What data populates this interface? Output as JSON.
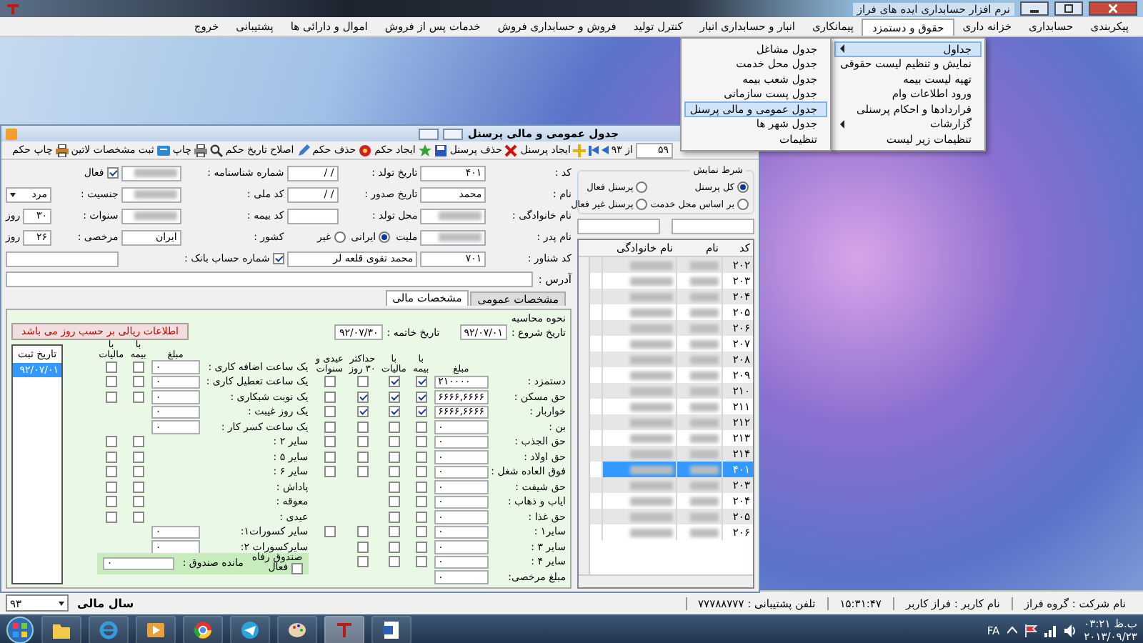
{
  "app_title": "نرم افزار حسابداری ایده های فراز",
  "menu_bar": [
    {
      "label": "پیکربندی",
      "selected": false
    },
    {
      "label": "حسابداری",
      "selected": false
    },
    {
      "label": "خزانه داری",
      "selected": false
    },
    {
      "label": "حقوق و دستمزد",
      "selected": true
    },
    {
      "label": "پیمانکاری",
      "selected": false
    },
    {
      "label": "انبار و حسابداری انبار",
      "selected": false
    },
    {
      "label": "کنترل تولید",
      "selected": false
    },
    {
      "label": "فروش و حسابداری فروش",
      "selected": false
    },
    {
      "label": "خدمات پس از فروش",
      "selected": false
    },
    {
      "label": "اموال و دارائی ها",
      "selected": false
    },
    {
      "label": "پشتیبانی",
      "selected": false
    },
    {
      "label": "خروج",
      "selected": false
    }
  ],
  "payroll_menu": [
    {
      "label": "جداول",
      "selected": true,
      "has_submenu": true
    },
    {
      "label": "نمایش و تنظیم لیست حقوقی",
      "selected": false,
      "has_submenu": false
    },
    {
      "label": "تهیه لیست بیمه",
      "selected": false,
      "has_submenu": false
    },
    {
      "label": "ورود اطلاعات وام",
      "selected": false,
      "has_submenu": false
    },
    {
      "label": "قراردادها و احکام پرسنلی",
      "selected": false,
      "has_submenu": false
    },
    {
      "label": "گزارشات",
      "selected": false,
      "has_submenu": true
    },
    {
      "label": "تنظیمات زیر لیست",
      "selected": false,
      "has_submenu": false
    }
  ],
  "tables_submenu": [
    {
      "label": "جدول مشاغل",
      "selected": false
    },
    {
      "label": "جدول محل خدمت",
      "selected": false
    },
    {
      "label": "جدول شعب بیمه",
      "selected": false
    },
    {
      "label": "جدول پست سازمانی",
      "selected": false
    },
    {
      "label": "جدول عمومی و مالی پرسنل",
      "selected": true
    },
    {
      "label": "جدول شهر ها",
      "selected": false
    },
    {
      "label": "تنظیمات",
      "selected": false
    }
  ],
  "window": {
    "title": "جدول عمومی و مالی پرسنل",
    "toolbar": {
      "record": "۵۹",
      "record_count": "از ۹۳",
      "buttons": [
        {
          "kind": "add",
          "label": "ایجاد پرسنل"
        },
        {
          "kind": "delete",
          "label": "حذف پرسنل"
        },
        {
          "kind": "save"
        },
        {
          "kind": "new_order",
          "label": "ایجاد حکم"
        },
        {
          "kind": "delete_order",
          "label": "حذف حکم"
        },
        {
          "kind": "edit",
          "label": "اصلاح تاریخ حکم"
        },
        {
          "kind": "search"
        },
        {
          "kind": "print",
          "label": "چاپ"
        },
        {
          "kind": "latin",
          "label": "ثبت مشخصات لاتین"
        },
        {
          "kind": "print_order",
          "label": "چاپ حکم"
        }
      ]
    },
    "display_filter": {
      "title": "شرط نمایش",
      "options": [
        {
          "label": "کل پرسنل",
          "selected": true
        },
        {
          "label": "پرسنل فعال",
          "selected": false
        },
        {
          "label": "بر اساس محل خدمت",
          "selected": false
        },
        {
          "label": "پرسنل غیر فعال",
          "selected": false
        }
      ]
    },
    "personnel_list": {
      "columns": [
        "کد",
        "نام",
        "نام خانوادگی"
      ],
      "rows": [
        {
          "code": "۲۰۲",
          "selected": false
        },
        {
          "code": "۲۰۳",
          "selected": false
        },
        {
          "code": "۲۰۴",
          "selected": false
        },
        {
          "code": "۲۰۵",
          "selected": false
        },
        {
          "code": "۲۰۶",
          "selected": false
        },
        {
          "code": "۲۰۷",
          "selected": false
        },
        {
          "code": "۲۰۸",
          "selected": false
        },
        {
          "code": "۲۰۹",
          "selected": false
        },
        {
          "code": "۲۱۰",
          "selected": false
        },
        {
          "code": "۲۱۱",
          "selected": false
        },
        {
          "code": "۲۱۲",
          "selected": false
        },
        {
          "code": "۲۱۳",
          "selected": false
        },
        {
          "code": "۲۱۴",
          "selected": false
        },
        {
          "code": "۴۰۱",
          "selected": true
        },
        {
          "code": "۲۰۳",
          "selected": false
        },
        {
          "code": "۲۰۴",
          "selected": false
        },
        {
          "code": "۲۰۵",
          "selected": false
        },
        {
          "code": "۲۰۶",
          "selected": false
        }
      ]
    },
    "fields": [
      [
        {
          "label": "کد :",
          "value": "۴۰۱"
        },
        {
          "label": "تاریخ تولد :",
          "value": "/ /"
        },
        {
          "label": "شماره شناسنامه :",
          "redacted": true
        },
        {
          "kind": "checkbox",
          "label": "فعال",
          "checked": true
        }
      ],
      [
        {
          "label": "نام :",
          "value": "محمد"
        },
        {
          "label": "تاریخ صدور :",
          "value": "/ /"
        },
        {
          "label": "کد ملی :",
          "redacted": true
        },
        {
          "kind": "dropdown",
          "label": "جنسیت :",
          "value": "مرد"
        }
      ],
      [
        {
          "label": "نام خانوادگی :",
          "redacted": true
        },
        {
          "label": "محل تولد :"
        },
        {
          "label": "کد بیمه :",
          "redacted": true
        },
        {
          "kind": "days",
          "label": "سنوات :",
          "value": "۳۰",
          "unit": "روز"
        }
      ],
      [
        {
          "label": "نام پدر :",
          "redacted": true
        },
        {
          "kind": "radios",
          "label": "ملیت",
          "options": [
            {
              "label": "ایرانی",
              "selected": true
            },
            {
              "label": "غیر",
              "selected": false
            }
          ]
        },
        {
          "label": "کشور :",
          "value": "ایران"
        },
        {
          "kind": "days",
          "label": "مرخصی :",
          "value": "۲۶",
          "unit": "روز"
        }
      ],
      [
        {
          "label": "کد شناور :",
          "value": "۷۰۱"
        },
        {
          "kind": "wide",
          "value": "محمد تقوی قلعه لر"
        },
        {
          "kind": "checkbox",
          "label": "شماره حساب بانک :",
          "checked": true
        },
        {
          "kind": "wide"
        }
      ]
    ],
    "address": {
      "label": "آدرس :"
    },
    "tabs": [
      {
        "label": "مشخصات عمومی",
        "selected": false
      },
      {
        "label": "مشخصات مالی",
        "selected": true
      }
    ],
    "financial": {
      "calc_title": "نحوه محاسبه",
      "start": {
        "label": "تاریخ شروع :",
        "value": "۹۲/۰۷/۰۱"
      },
      "end": {
        "label": "تاریخ خاتمه :",
        "value": "۹۲/۰۷/۳۰"
      },
      "note": "اطلاعات ریالی بر حسب روز می باشد",
      "earnings_columns": [
        "مبلغ",
        "با بیمه",
        "با مالیات",
        "حداکثر ۳۰ روز",
        "عیدی و سنوات"
      ],
      "earnings": [
        {
          "label": "دستمزد :",
          "amount": "۲۱۰۰۰۰",
          "insured": true,
          "taxed": true,
          "max_30_days": false,
          "bonus": false
        },
        {
          "label": "حق مسکن :",
          "amount": "۶۶۶۶,۶۶۶۶",
          "insured": true,
          "taxed": true,
          "max_30_days": true,
          "bonus": false
        },
        {
          "label": "خواربار :",
          "amount": "۶۶۶۶,۶۶۶۶",
          "insured": true,
          "taxed": true,
          "max_30_days": true,
          "bonus": false
        },
        {
          "label": "بن :",
          "amount": "۰",
          "insured": false,
          "taxed": false,
          "max_30_days": false,
          "bonus": false
        },
        {
          "label": "حق الجذب :",
          "amount": "۰",
          "insured": false,
          "taxed": false,
          "max_30_days": false,
          "bonus": false
        },
        {
          "label": "حق اولاد :",
          "amount": "۰",
          "insured": false,
          "taxed": false,
          "max_30_days": false,
          "bonus": false
        },
        {
          "label": "فوق العاده شغل :",
          "amount": "۰",
          "insured": false,
          "taxed": false,
          "max_30_days": false,
          "bonus": false
        },
        {
          "label": "حق شیفت :",
          "amount": "۰",
          "insured": false,
          "taxed": false
        },
        {
          "label": "ایاب و ذهاب :",
          "amount": "۰",
          "insured": false,
          "taxed": false
        },
        {
          "label": "حق غذا :",
          "amount": "۰",
          "insured": false,
          "taxed": false
        },
        {
          "label": "سایر۱ :",
          "amount": "۰",
          "insured": false,
          "taxed": false,
          "max_30_days": false,
          "bonus": false
        },
        {
          "label": "سایر ۳ :",
          "amount": "۰",
          "insured": false,
          "taxed": false,
          "max_30_days": false
        },
        {
          "label": "سایر ۴ :",
          "amount": "۰",
          "insured": false,
          "taxed": false,
          "max_30_days": false
        },
        {
          "label": "مبلغ مرخصی:",
          "amount": "۰"
        }
      ],
      "extras_columns": [
        "مبلغ",
        "با بیمه",
        "با مالیات"
      ],
      "extras": [
        {
          "label": "یک ساعت اضافه کاری :",
          "amount": "۰",
          "insured": false,
          "taxed": false
        },
        {
          "label": "یک ساعت تعطیل کاری :",
          "amount": "۰",
          "insured": false,
          "taxed": false
        },
        {
          "label": "یک نوبت شبکاری :",
          "amount": "۰",
          "insured": false,
          "taxed": false
        },
        {
          "label": "یک روز غیبت :",
          "amount": "۰"
        },
        {
          "label": "یک ساعت کسر کار :",
          "amount": "۰"
        },
        {
          "label": "سایر ۲ :",
          "insured": false,
          "taxed": false
        },
        {
          "label": "سایر ۵ :",
          "insured": false,
          "taxed": false
        },
        {
          "label": "سایر ۶ :",
          "insured": false,
          "taxed": false
        },
        {
          "label": "پاداش :",
          "insured": false,
          "taxed": false
        },
        {
          "label": "معوقه :",
          "insured": false,
          "taxed": false
        },
        {
          "label": "عیدی :",
          "insured": false,
          "taxed": false
        },
        {
          "label": "سایر کسورات۱:",
          "amount": "۰"
        },
        {
          "label": "سایرکسورات ۲:",
          "amount": "۰"
        }
      ],
      "welfare_fund": {
        "title": "صندوق رفاه",
        "active_label": "فعال",
        "active": false,
        "balance_label": "مانده صندوق :",
        "balance": "۰"
      },
      "order_dates": {
        "header": "تاریخ ثبت",
        "rows": [
          {
            "date": "۹۲/۰۷/۰۱",
            "selected": true
          }
        ]
      }
    }
  },
  "status_bar": {
    "fiscal_year": "۹۳",
    "fiscal_year_label": "سال مالی",
    "company": "نام شرکت : گروه فراز",
    "user": "نام کاربر : فراز کاربر",
    "time": "۱۵:۳۱:۴۷",
    "phone": "تلفن پشتیبانی : ۷۷۷۸۸۷۷۷"
  },
  "taskbar": {
    "language": "FA",
    "clock": "۰۳:۲۱ ب.ظ",
    "date": "۲۰۱۳/۰۹/۲۳"
  }
}
